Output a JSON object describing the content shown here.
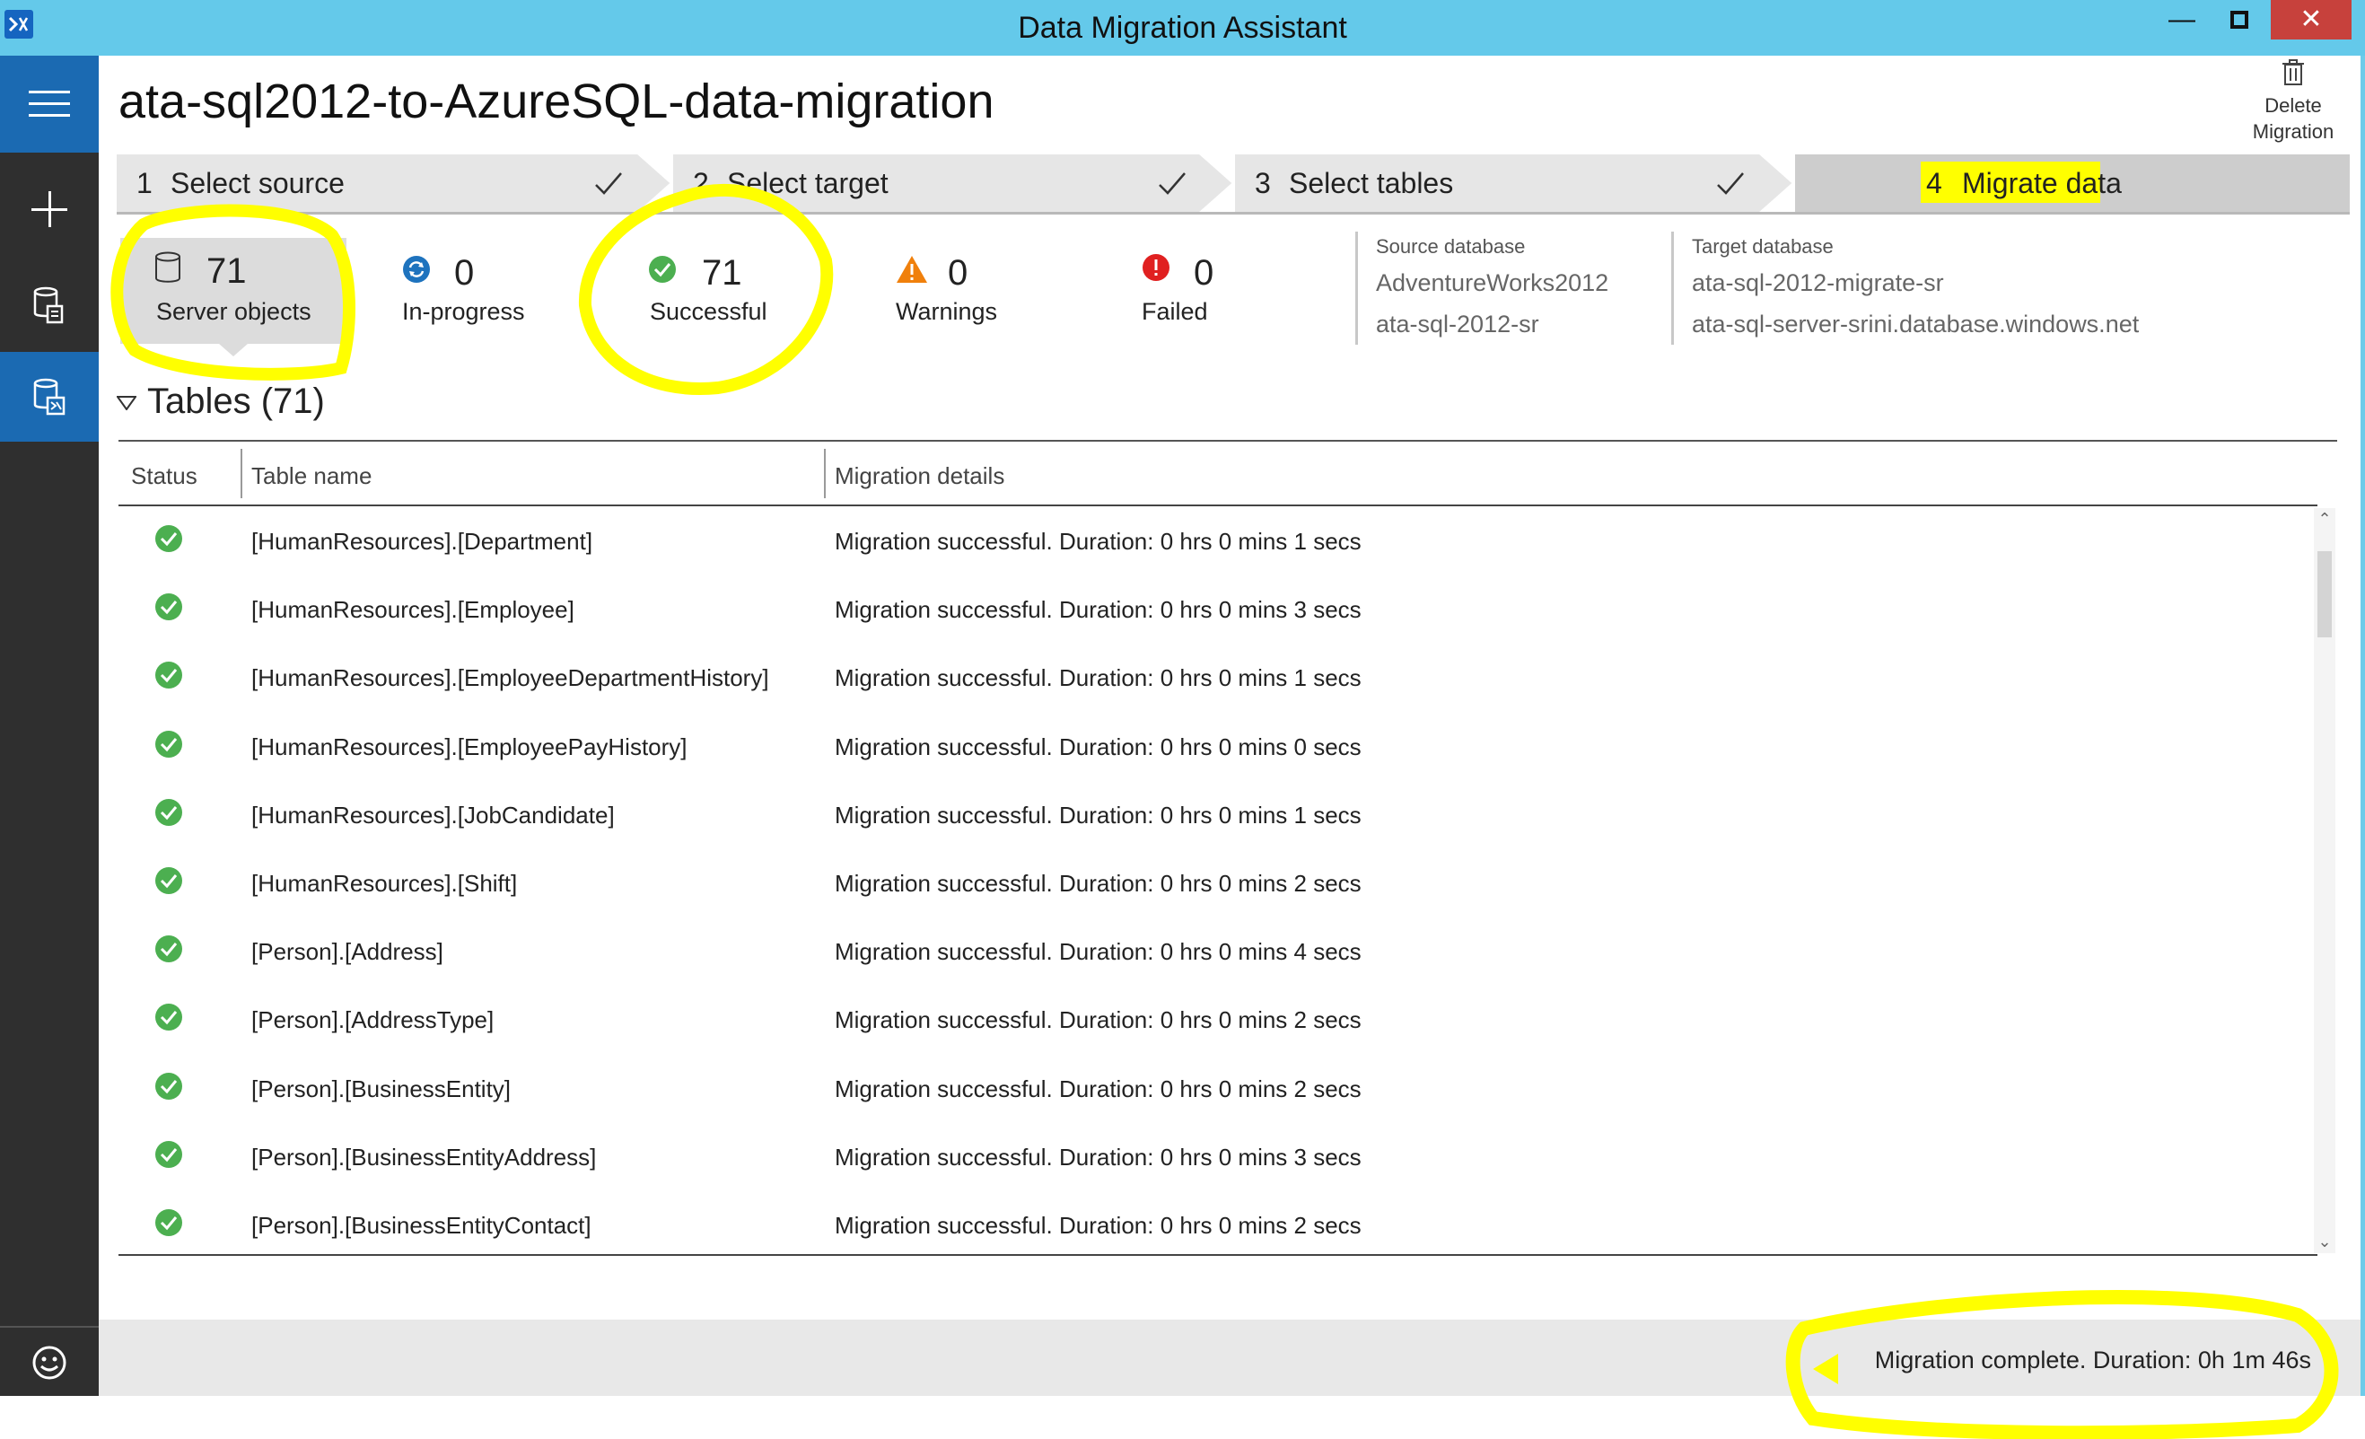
{
  "window": {
    "title": "Data Migration Assistant",
    "minimize_glyph": "—",
    "maximize_glyph": "□",
    "close_glyph": "✕"
  },
  "nav": {
    "items": [
      {
        "icon": "hamburger-menu-icon"
      },
      {
        "icon": "plus-icon"
      },
      {
        "icon": "assessment-icon"
      },
      {
        "icon": "migration-icon",
        "active": true
      },
      {
        "icon": "smiley-feedback-icon"
      }
    ]
  },
  "project": {
    "title": "ata-sql2012-to-AzureSQL-data-migration",
    "delete_label_line1": "Delete",
    "delete_label_line2": "Migration"
  },
  "steps": [
    {
      "num": "1",
      "label": "Select source",
      "done": true
    },
    {
      "num": "2",
      "label": "Select target",
      "done": true
    },
    {
      "num": "3",
      "label": "Select tables",
      "done": true
    },
    {
      "num": "4",
      "label": "Migrate data",
      "active": true
    }
  ],
  "summary": {
    "server_objects": {
      "count": "71",
      "label": "Server objects"
    },
    "in_progress": {
      "count": "0",
      "label": "In-progress"
    },
    "successful": {
      "count": "71",
      "label": "Successful"
    },
    "warnings": {
      "count": "0",
      "label": "Warnings"
    },
    "failed": {
      "count": "0",
      "label": "Failed"
    }
  },
  "source": {
    "heading": "Source database",
    "database": "AdventureWorks2012",
    "server": "ata-sql-2012-sr"
  },
  "target": {
    "heading": "Target database",
    "database": "ata-sql-2012-migrate-sr",
    "server": "ata-sql-server-srini.database.windows.net"
  },
  "tables": {
    "header": "Tables (71)",
    "columns": [
      "Status",
      "Table name",
      "Migration details"
    ],
    "rows": [
      {
        "name": "[HumanResources].[Department]",
        "details": "Migration successful. Duration: 0 hrs 0 mins 1 secs"
      },
      {
        "name": "[HumanResources].[Employee]",
        "details": "Migration successful. Duration: 0 hrs 0 mins 3 secs"
      },
      {
        "name": "[HumanResources].[EmployeeDepartmentHistory]",
        "details": "Migration successful. Duration: 0 hrs 0 mins 1 secs"
      },
      {
        "name": "[HumanResources].[EmployeePayHistory]",
        "details": "Migration successful. Duration: 0 hrs 0 mins 0 secs"
      },
      {
        "name": "[HumanResources].[JobCandidate]",
        "details": "Migration successful. Duration: 0 hrs 0 mins 1 secs"
      },
      {
        "name": "[HumanResources].[Shift]",
        "details": "Migration successful. Duration: 0 hrs 0 mins 2 secs"
      },
      {
        "name": "[Person].[Address]",
        "details": "Migration successful. Duration: 0 hrs 0 mins 4 secs"
      },
      {
        "name": "[Person].[AddressType]",
        "details": "Migration successful. Duration: 0 hrs 0 mins 2 secs"
      },
      {
        "name": "[Person].[BusinessEntity]",
        "details": "Migration successful. Duration: 0 hrs 0 mins 2 secs"
      },
      {
        "name": "[Person].[BusinessEntityAddress]",
        "details": "Migration successful. Duration: 0 hrs 0 mins 3 secs"
      },
      {
        "name": "[Person].[BusinessEntityContact]",
        "details": "Migration successful. Duration: 0 hrs 0 mins 2 secs"
      }
    ]
  },
  "status": {
    "text": "Migration complete. Duration:  0h 1m 46s"
  },
  "colors": {
    "titlebar": "#64c9ea",
    "nav_bg": "#2f2f2f",
    "nav_active": "#1b6ab2",
    "success": "#4caf50",
    "warning": "#f0800c",
    "failed": "#e02020",
    "progress": "#1e73be",
    "highlight": "#ffff00"
  }
}
